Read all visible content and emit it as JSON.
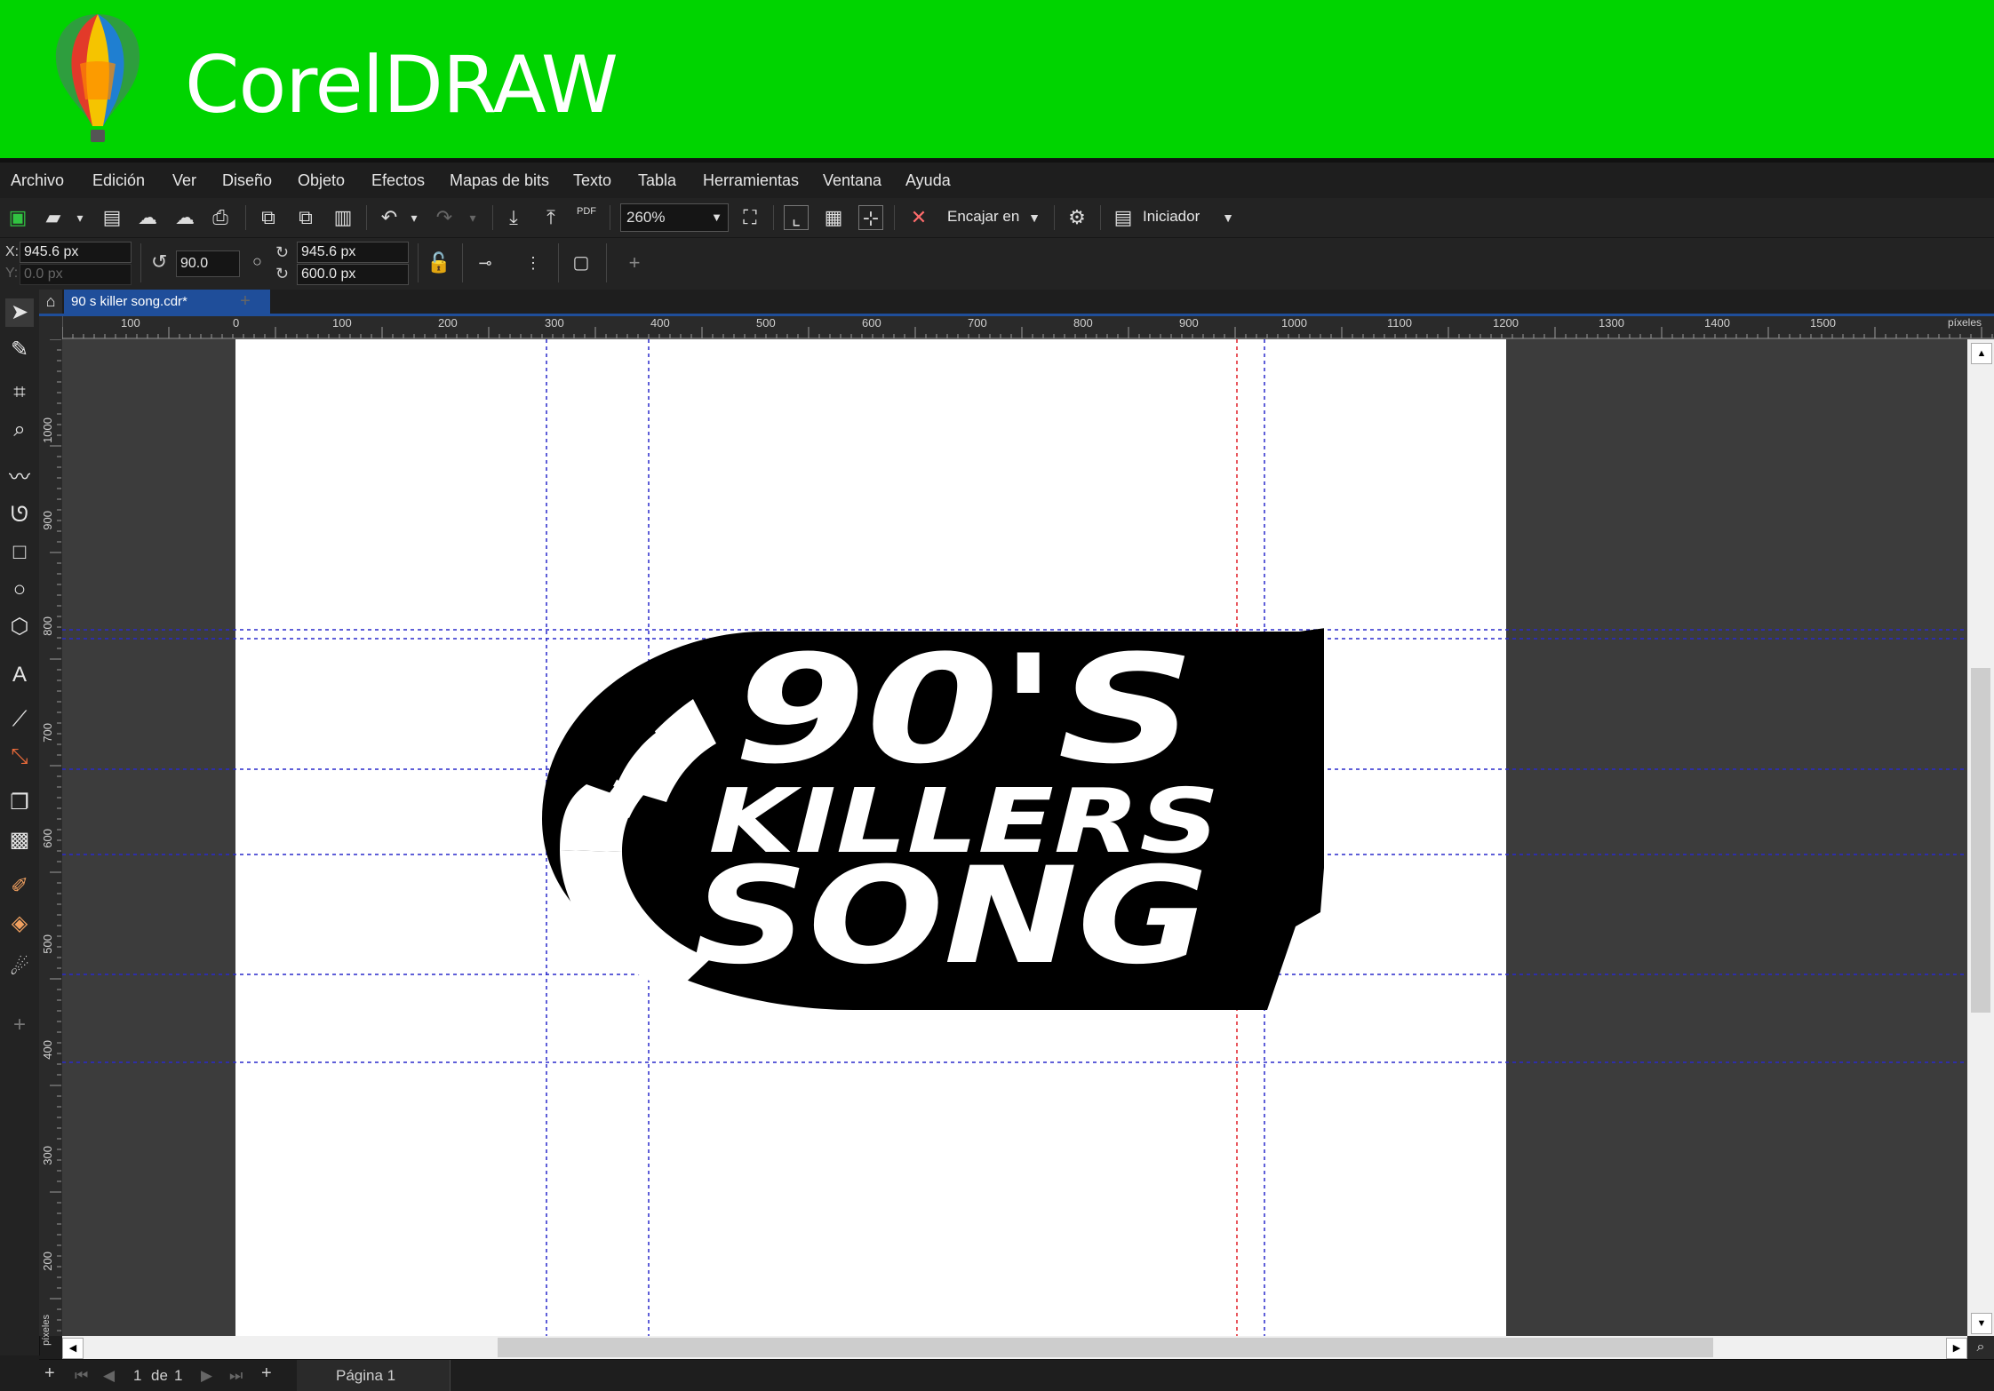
{
  "banner": {
    "title": "CorelDRAW"
  },
  "menu": [
    "Archivo",
    "Edición",
    "Ver",
    "Diseño",
    "Objeto",
    "Efectos",
    "Mapas de bits",
    "Texto",
    "Tabla",
    "Herramientas",
    "Ventana",
    "Ayuda"
  ],
  "toolbar": {
    "zoom": "260%",
    "snap_label": "Encajar en",
    "launcher_label": "Iniciador",
    "pdf_label": "PDF"
  },
  "properties": {
    "x_label": "X:",
    "x_value": "945.6 px",
    "y_label": "Y:",
    "y_value": "0.0 px",
    "rotation": "90.0",
    "width": "945.6 px",
    "height": "600.0 px"
  },
  "document": {
    "tab_title": "90 s killer song.cdr*"
  },
  "ruler": {
    "unit": "píxeles",
    "h_ticks": [
      "100",
      "0",
      "100",
      "200",
      "300",
      "400",
      "500",
      "600",
      "700",
      "800",
      "900",
      "1000",
      "1100",
      "1200",
      "1300",
      "1400",
      "1500"
    ],
    "v_ticks": [
      "1000",
      "900",
      "800",
      "700",
      "600",
      "500",
      "400",
      "300",
      "200"
    ],
    "v_unit": "píxeles"
  },
  "artwork": {
    "line1": "90'S",
    "line2": "KILLERS",
    "line3": "SONG"
  },
  "status": {
    "page_current": "1",
    "page_of": "de",
    "page_total": "1",
    "page_tab": "Página 1"
  }
}
